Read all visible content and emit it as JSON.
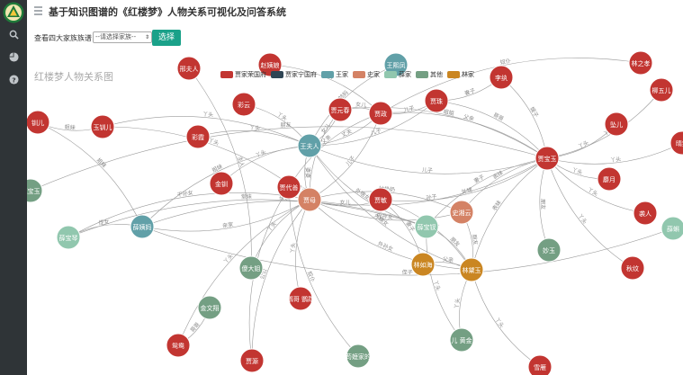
{
  "app": {
    "title": "基于知识图谱的《红楼梦》人物关系可视化及问答系统"
  },
  "sidebar": {
    "items": [
      {
        "icon": "search-icon"
      },
      {
        "icon": "pie-chart-icon"
      },
      {
        "icon": "question-icon"
      }
    ]
  },
  "filter": {
    "label": "查看四大家族族谱",
    "select_value": "--请选择家族--",
    "button": "选择"
  },
  "graph": {
    "title": "红楼梦人物关系图",
    "legend": [
      {
        "label": "贾家荣国府",
        "color": "#c23531"
      },
      {
        "label": "贾家宁国府",
        "color": "#2f4554"
      },
      {
        "label": "王家",
        "color": "#61a0a8"
      },
      {
        "label": "史家",
        "color": "#d48265"
      },
      {
        "label": "薛家",
        "color": "#91c7ae"
      },
      {
        "label": "其他",
        "color": "#749f83"
      },
      {
        "label": "林家",
        "color": "#ca8622"
      }
    ],
    "nodes": [
      {
        "name": "薛姨妈",
        "cat": 2
      },
      {
        "name": "薛宝琴",
        "cat": 4
      },
      {
        "name": "王夫人",
        "cat": 2
      },
      {
        "name": "贾母",
        "cat": 3
      },
      {
        "name": "贾宝玉",
        "cat": 0
      },
      {
        "name": "林如海",
        "cat": 6
      },
      {
        "name": "林黛玉",
        "cat": 6
      },
      {
        "name": "薛宝钗",
        "cat": 4
      },
      {
        "name": "史湘云",
        "cat": 3
      },
      {
        "name": "贾政",
        "cat": 0
      },
      {
        "name": "贾敏",
        "cat": 0
      },
      {
        "name": "贾代善",
        "cat": 0
      },
      {
        "name": "贾元春",
        "cat": 0
      },
      {
        "name": "贾珠",
        "cat": 0
      },
      {
        "name": "李纨",
        "cat": 0
      },
      {
        "name": "彩云",
        "cat": 0
      },
      {
        "name": "彩霞",
        "cat": 0
      },
      {
        "name": "金钏",
        "cat": 0
      },
      {
        "name": "玉钏儿",
        "cat": 0
      },
      {
        "name": "钏儿",
        "cat": 0
      },
      {
        "name": "傻大姐",
        "cat": 5
      },
      {
        "name": "金文翔",
        "cat": 5
      },
      {
        "name": "鸳鸯",
        "cat": 0
      },
      {
        "name": "贾源",
        "cat": 0
      },
      {
        "name": "鹦哥 鹦鹉",
        "cat": 0
      },
      {
        "name": "苟嬷家的",
        "cat": 5
      },
      {
        "name": "儿 黄金",
        "cat": 5
      },
      {
        "name": "雪雁",
        "cat": 0
      },
      {
        "name": "妙玉",
        "cat": 5
      },
      {
        "name": "秋纹",
        "cat": 0
      },
      {
        "name": "袭人",
        "cat": 0
      },
      {
        "name": "麝月",
        "cat": 0
      },
      {
        "name": "坠儿",
        "cat": 0
      },
      {
        "name": "柳五儿",
        "cat": 0
      },
      {
        "name": "晴雯",
        "cat": 0
      },
      {
        "name": "薛蝌",
        "cat": 4
      },
      {
        "name": "甄宝玉",
        "cat": 5
      },
      {
        "name": "赵姨娘",
        "cat": 0
      },
      {
        "name": "林之孝",
        "cat": 0
      },
      {
        "name": "邢夫人",
        "cat": 0
      },
      {
        "name": "王熙凤",
        "cat": 2
      }
    ],
    "edges": [
      {
        "s": "王夫人",
        "t": "薛姨妈",
        "label": "姐妹"
      },
      {
        "s": "王夫人",
        "t": "贾政",
        "label": "丈夫"
      },
      {
        "s": "王夫人",
        "t": "贾宝玉",
        "label": "儿子"
      },
      {
        "s": "王夫人",
        "t": "贾元春",
        "label": "女儿"
      },
      {
        "s": "王夫人",
        "t": "贾珠",
        "label": "儿子"
      },
      {
        "s": "王夫人",
        "t": "彩云",
        "label": "丫头"
      },
      {
        "s": "王夫人",
        "t": "彩霞",
        "label": "丫头"
      },
      {
        "s": "王夫人",
        "t": "金钏",
        "label": "丫头"
      },
      {
        "s": "王夫人",
        "t": "玉钏儿",
        "label": "丫头"
      },
      {
        "s": "王夫人",
        "t": "贾母",
        "label": "婆婆"
      },
      {
        "s": "王夫人",
        "t": "薛宝钗",
        "label": "外甥女"
      },
      {
        "s": "王夫人",
        "t": "林黛玉",
        "label": "外甥女"
      },
      {
        "s": "贾母",
        "t": "贾代善",
        "label": "丈夫"
      },
      {
        "s": "贾母",
        "t": "贾政",
        "label": "儿子"
      },
      {
        "s": "贾母",
        "t": "贾敏",
        "label": "女儿"
      },
      {
        "s": "贾母",
        "t": "贾宝玉",
        "label": "孙子"
      },
      {
        "s": "贾母",
        "t": "林黛玉",
        "label": "外孙女"
      },
      {
        "s": "贾母",
        "t": "鸳鸯",
        "label": "丫头"
      },
      {
        "s": "贾母",
        "t": "傻大姐",
        "label": "丫头"
      },
      {
        "s": "贾母",
        "t": "鹦哥 鹦鹉",
        "label": "丫头"
      },
      {
        "s": "贾母",
        "t": "史湘云",
        "label": "侄孙女"
      },
      {
        "s": "贾母",
        "t": "贾源",
        "label": "公公"
      },
      {
        "s": "贾母",
        "t": "薛宝琴",
        "label": "干孙女"
      },
      {
        "s": "贾宝玉",
        "t": "林黛玉",
        "label": "表妹"
      },
      {
        "s": "贾宝玉",
        "t": "薛宝钗",
        "label": "妻子"
      },
      {
        "s": "贾宝玉",
        "t": "袭人",
        "label": "丫头"
      },
      {
        "s": "贾宝玉",
        "t": "麝月",
        "label": "丫头"
      },
      {
        "s": "贾宝玉",
        "t": "晴雯",
        "label": "丫头"
      },
      {
        "s": "贾宝玉",
        "t": "秋纹",
        "label": "丫头"
      },
      {
        "s": "贾宝玉",
        "t": "坠儿",
        "label": "丫头"
      },
      {
        "s": "贾宝玉",
        "t": "柳五儿",
        "label": "丫头"
      },
      {
        "s": "贾宝玉",
        "t": "李纨",
        "label": "嫂子"
      },
      {
        "s": "贾宝玉",
        "t": "贾珠",
        "label": "哥哥"
      },
      {
        "s": "贾宝玉",
        "t": "妙玉",
        "label": "朋友"
      },
      {
        "s": "贾宝玉",
        "t": "史湘云",
        "label": "表妹"
      },
      {
        "s": "贾宝玉",
        "t": "甄宝玉",
        "label": "朋友"
      },
      {
        "s": "贾宝玉",
        "t": "贾政",
        "label": "父亲"
      },
      {
        "s": "贾宝玉",
        "t": "贾元春",
        "label": "姐姐"
      },
      {
        "s": "林黛玉",
        "t": "林如海",
        "label": "父亲"
      },
      {
        "s": "林黛玉",
        "t": "雪雁",
        "label": "丫头"
      },
      {
        "s": "林黛玉",
        "t": "贾敏",
        "label": "母亲"
      },
      {
        "s": "林黛玉",
        "t": "薛宝钗",
        "label": "朋友"
      },
      {
        "s": "林黛玉",
        "t": "史湘云",
        "label": "朋友"
      },
      {
        "s": "林黛玉",
        "t": "儿 黄金",
        "label": "丫头"
      },
      {
        "s": "林如海",
        "t": "贾敏",
        "label": "妻子"
      },
      {
        "s": "薛宝钗",
        "t": "薛姨妈",
        "label": "母亲"
      },
      {
        "s": "薛宝钗",
        "t": "薛宝琴",
        "label": "堂妹"
      },
      {
        "s": "薛宝钗",
        "t": "儿 黄金",
        "label": "丫头"
      },
      {
        "s": "薛姨妈",
        "t": "薛宝琴",
        "label": "侄女"
      },
      {
        "s": "薛姨妈",
        "t": "薛蝌",
        "label": "侄子"
      },
      {
        "s": "薛姨妈",
        "t": "钏儿",
        "label": "姐妹"
      },
      {
        "s": "薛姨妈",
        "t": "贾母",
        "label": "亲家"
      },
      {
        "s": "贾政",
        "t": "贾代善",
        "label": "父亲"
      },
      {
        "s": "贾政",
        "t": "贾珠",
        "label": "儿子"
      },
      {
        "s": "贾政",
        "t": "赵姨娘",
        "label": "妾"
      },
      {
        "s": "贾政",
        "t": "贾元春",
        "label": "女儿"
      },
      {
        "s": "贾珠",
        "t": "李纨",
        "label": "妻子"
      },
      {
        "s": "贾代善",
        "t": "贾源",
        "label": "父亲"
      },
      {
        "s": "贾代善",
        "t": "苟嬷家的",
        "label": "奴仆"
      },
      {
        "s": "鸳鸯",
        "t": "金文翔",
        "label": "哥哥"
      },
      {
        "s": "傻大姐",
        "t": "邢夫人",
        "label": "主人"
      },
      {
        "s": "贾母",
        "t": "玉钏儿",
        "label": "丫头"
      },
      {
        "s": "贾元春",
        "t": "贾母",
        "label": "孙女"
      },
      {
        "s": "钏儿",
        "t": "玉钏儿",
        "label": "姐妹"
      },
      {
        "s": "贾敏",
        "t": "贾宝玉",
        "label": "外甥"
      },
      {
        "s": "王熙凤",
        "t": "王夫人",
        "label": "姑妈"
      },
      {
        "s": "林之孝",
        "t": "贾政",
        "label": "奴仆"
      },
      {
        "s": "史湘云",
        "t": "贾母",
        "label": "姑奶奶"
      }
    ]
  }
}
